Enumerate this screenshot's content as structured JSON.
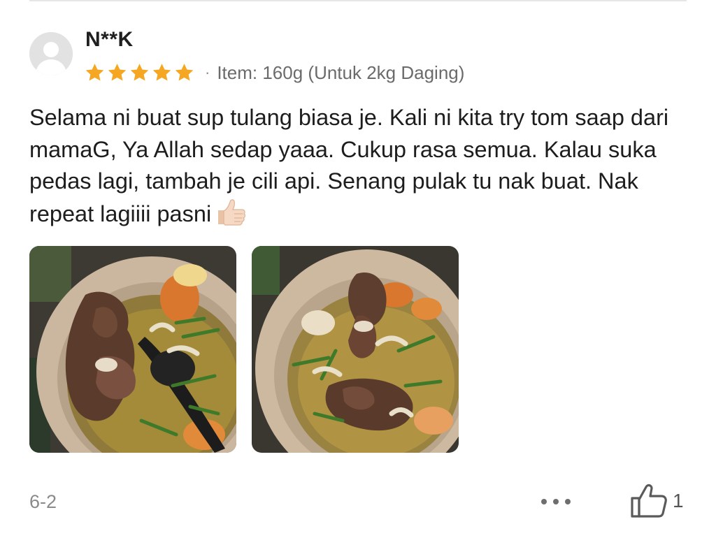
{
  "review": {
    "username": "N**K",
    "rating": 5,
    "variant_text": "Item: 160g (Untuk 2kg Daging)",
    "separator": "·",
    "body": "Selama ni buat sup tulang biasa je. Kali ni kita try tom saap dari mamaG, Ya Allah sedap yaaa. Cukup rasa semua. Kalau suka pedas lagi, tambah je cili api. Senang pulak tu nak buat. Nak repeat lagiiii pasni",
    "emoji": "thumbs-up-icon",
    "photos": [
      {
        "name": "soup-photo-1",
        "description": "bone soup in pot with ladle"
      },
      {
        "name": "soup-photo-2",
        "description": "bone soup in pot"
      }
    ],
    "date": "6-2",
    "like_count": "1"
  },
  "colors": {
    "star": "#F5A623",
    "text_primary": "#1d1d1d",
    "text_secondary": "#8a8a8a",
    "divider": "#e6e6e6"
  }
}
